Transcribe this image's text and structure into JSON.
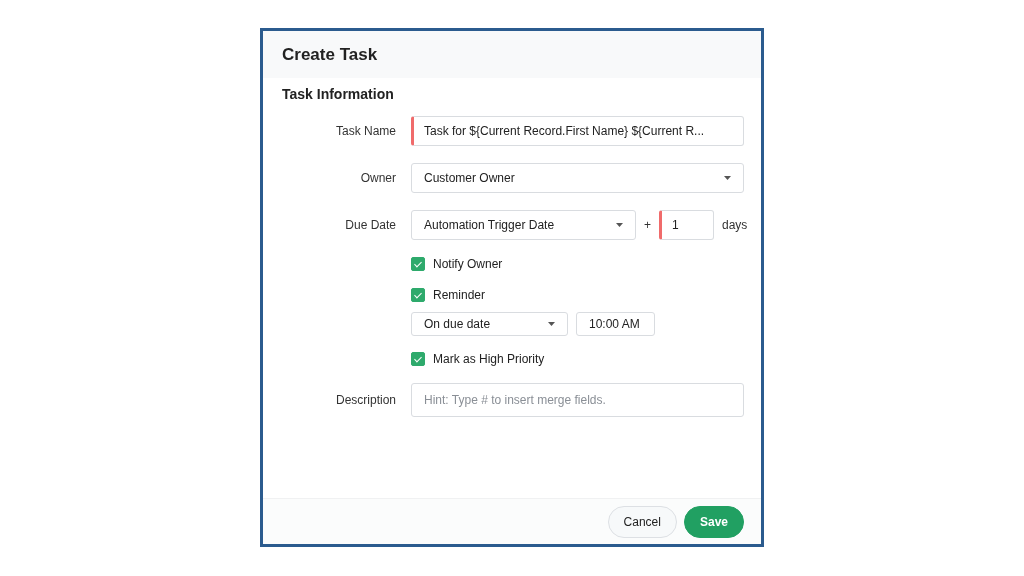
{
  "dialog": {
    "title": "Create Task"
  },
  "section": {
    "title": "Task Information"
  },
  "task_name": {
    "label": "Task Name",
    "value": "Task for ${Current Record.First Name} ${Current R...",
    "required": true
  },
  "owner": {
    "label": "Owner",
    "value": "Customer Owner"
  },
  "due_date": {
    "label": "Due Date",
    "value": "Automation Trigger Date",
    "plus": "+",
    "offset": {
      "value": "1",
      "required": true
    },
    "unit": "days"
  },
  "notify_owner": {
    "label": "Notify Owner",
    "checked": true
  },
  "reminder": {
    "label": "Reminder",
    "checked": true,
    "when": "On due date",
    "time": "10:00 AM"
  },
  "high_priority": {
    "label": "Mark as High Priority",
    "checked": true
  },
  "description": {
    "label": "Description",
    "placeholder": "Hint: Type # to insert merge fields."
  },
  "buttons": [
    {
      "label": "Cancel",
      "kind": "secondary"
    },
    {
      "label": "Save",
      "kind": "primary"
    }
  ]
}
